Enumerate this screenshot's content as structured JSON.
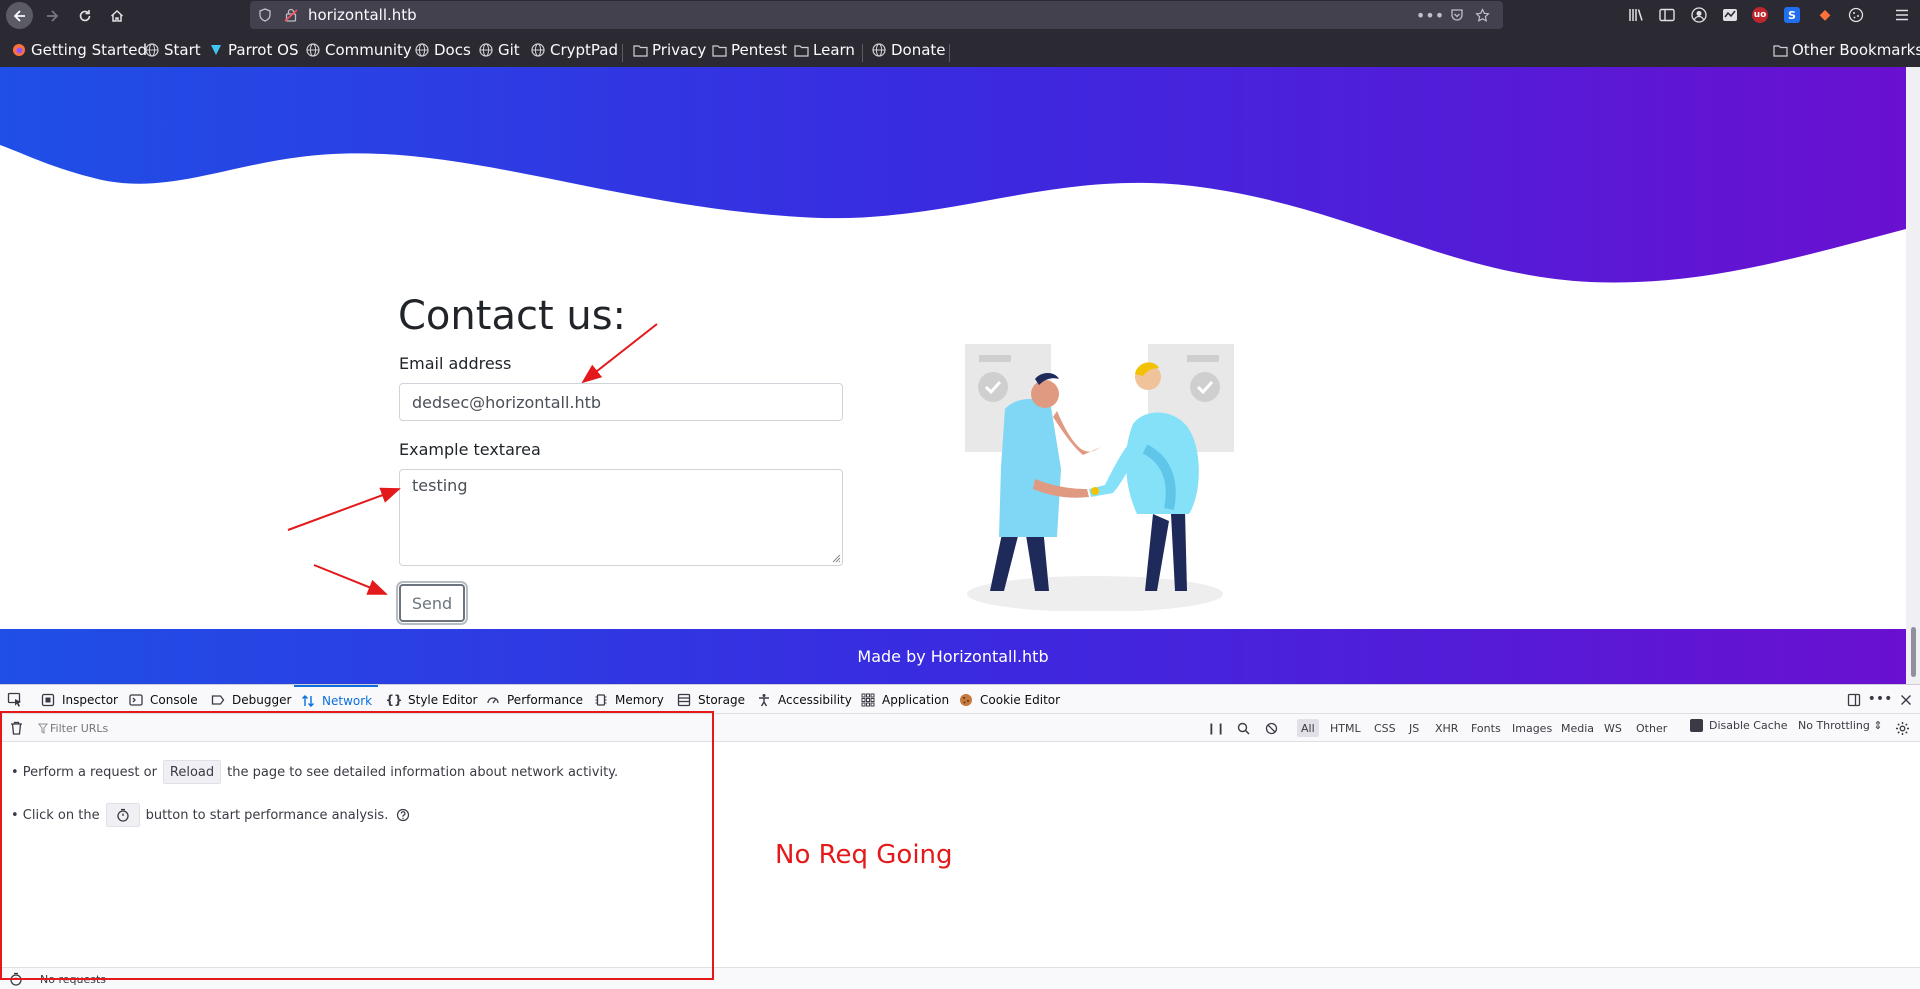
{
  "browser": {
    "url": "horizontall.htb",
    "bookmarks": [
      {
        "label": "Getting Started",
        "icon": "firefox-icon"
      },
      {
        "label": "Start",
        "icon": "globe-icon"
      },
      {
        "label": "Parrot OS",
        "icon": "parrot-icon"
      },
      {
        "label": "Community",
        "icon": "globe-icon"
      },
      {
        "label": "Docs",
        "icon": "globe-icon"
      },
      {
        "label": "Git",
        "icon": "globe-icon"
      },
      {
        "label": "CryptPad",
        "icon": "globe-icon"
      },
      {
        "label": "Privacy",
        "icon": "folder-icon"
      },
      {
        "label": "Pentest",
        "icon": "folder-icon"
      },
      {
        "label": "Learn",
        "icon": "folder-icon"
      },
      {
        "label": "Donate",
        "icon": "globe-icon"
      }
    ],
    "other_bookmarks": "Other Bookmarks"
  },
  "page": {
    "contact_title": "Contact us:",
    "email_label": "Email address",
    "email_value": "dedsec@horizontall.htb",
    "textarea_label": "Example textarea",
    "textarea_value": "testing",
    "send_label": "Send",
    "footer_text": "Made by Horizontall.htb",
    "colors": {
      "gradient_start": "#1f4fe6",
      "gradient_mid": "#3a2ae0",
      "gradient_end": "#6a10d0"
    }
  },
  "devtools": {
    "tabs": [
      {
        "label": "Inspector",
        "icon": "inspector-icon"
      },
      {
        "label": "Console",
        "icon": "console-icon"
      },
      {
        "label": "Debugger",
        "icon": "debugger-icon"
      },
      {
        "label": "Network",
        "icon": "network-icon",
        "active": true
      },
      {
        "label": "Style Editor",
        "icon": "braces-icon"
      },
      {
        "label": "Performance",
        "icon": "gauge-icon"
      },
      {
        "label": "Memory",
        "icon": "memory-icon"
      },
      {
        "label": "Storage",
        "icon": "storage-icon"
      },
      {
        "label": "Accessibility",
        "icon": "accessibility-icon"
      },
      {
        "label": "Application",
        "icon": "grid-icon"
      },
      {
        "label": "Cookie Editor",
        "icon": "cookie-icon"
      }
    ],
    "filter_placeholder": "Filter URLs",
    "filter_types": [
      "All",
      "HTML",
      "CSS",
      "JS",
      "XHR",
      "Fonts",
      "Images",
      "Media",
      "WS",
      "Other"
    ],
    "disable_cache": "Disable Cache",
    "throttling": "No Throttling",
    "empty_line1_pre": "• Perform a request or",
    "reload_label": "Reload",
    "empty_line1_post": "the page to see detailed information about network activity.",
    "empty_line2_pre": "• Click on the",
    "empty_line2_post": "button to start performance analysis.",
    "status": "No requests"
  },
  "annotation": {
    "text": "No Req Going",
    "color": "#e3191b"
  }
}
